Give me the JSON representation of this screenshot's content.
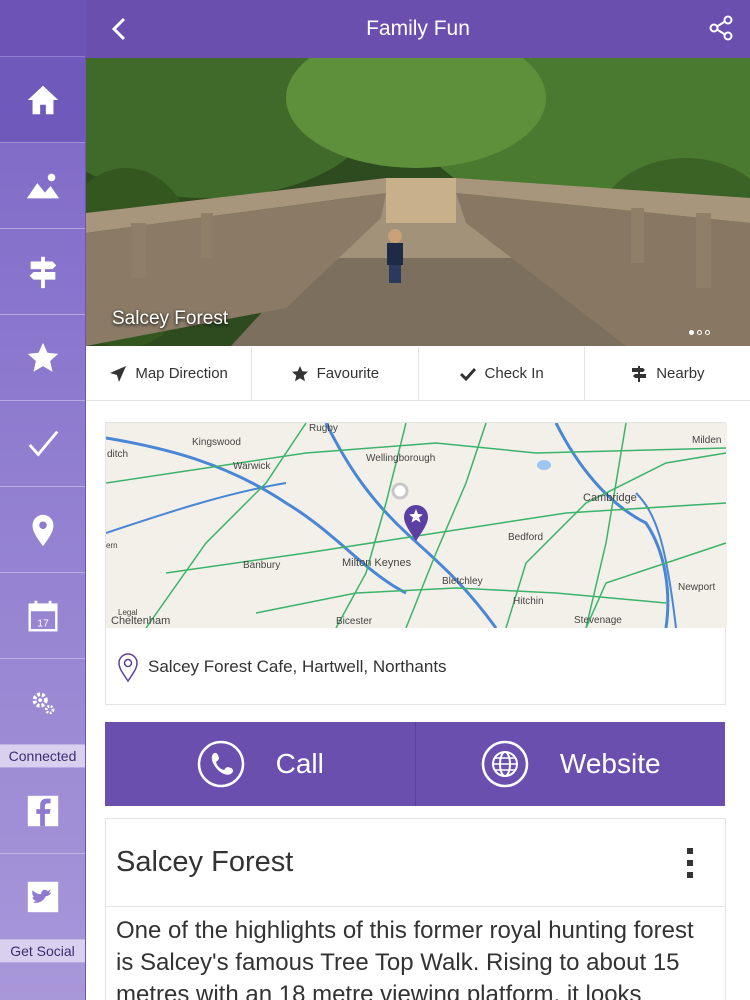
{
  "header": {
    "title": "Family Fun"
  },
  "sidebar": {
    "connected_label": "Connected",
    "social_label": "Get Social",
    "calendar_day": "17",
    "icons": [
      "home-icon",
      "image-icon",
      "signpost-icon",
      "star-icon",
      "check-icon",
      "map-pin-icon",
      "calendar-icon",
      "settings-icon",
      "facebook-icon",
      "twitter-icon"
    ]
  },
  "hero": {
    "caption": "Salcey Forest",
    "slides": 3,
    "active_slide": 1
  },
  "actions": [
    {
      "label": "Map Direction",
      "icon": "navigation-arrow-icon"
    },
    {
      "label": "Favourite",
      "icon": "star-icon"
    },
    {
      "label": "Check In",
      "icon": "check-icon"
    },
    {
      "label": "Nearby",
      "icon": "signpost-icon"
    }
  ],
  "map": {
    "labels": [
      "Rugby",
      "Kingswood",
      "Milden",
      "ditch",
      "Warwick",
      "Wellingborough",
      "Cambridge",
      "Bedford",
      "Banbury",
      "Milton Keynes",
      "Bletchley",
      "Newport",
      "Hitchin",
      "Legal",
      "Cheltenham",
      "Bicester",
      "Stevenage",
      "ern"
    ]
  },
  "location": {
    "address": "Salcey Forest Cafe, Hartwell, Northants"
  },
  "contact": {
    "call_label": "Call",
    "website_label": "Website"
  },
  "info": {
    "title": "Salcey Forest",
    "description": "One of the highlights of this former royal hunting forest is Salcey's famous Tree Top Walk. Rising to about 15 metres with an 18 metre viewing platform, it looks"
  },
  "colors": {
    "brand": "#6a4fae",
    "sidebar": "#8e7bcf"
  }
}
